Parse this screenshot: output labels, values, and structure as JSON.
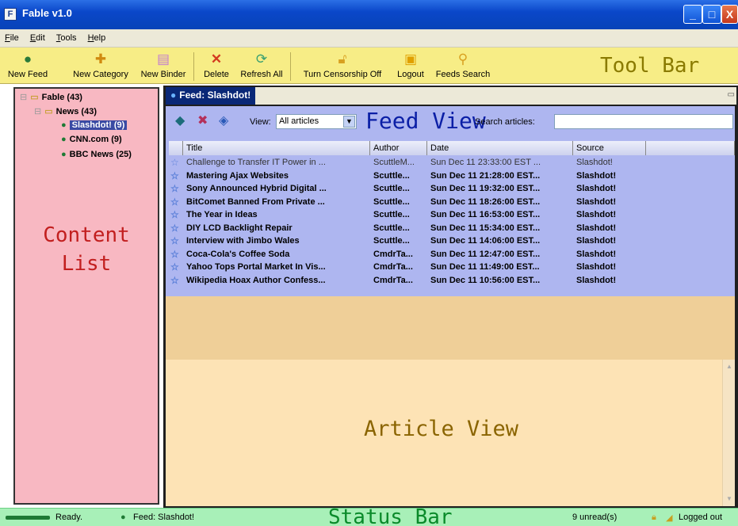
{
  "window": {
    "title": "Fable v1.0",
    "minimize": "_",
    "maximize": "□",
    "close": "X"
  },
  "menu": [
    "File",
    "Edit",
    "Tools",
    "Help"
  ],
  "toolbar": {
    "caption": "Tool Bar",
    "buttons": [
      {
        "label": "New Feed",
        "icon": "globe-icon"
      },
      {
        "label": "New Category",
        "icon": "folder-plus-icon"
      },
      {
        "label": "New Binder",
        "icon": "binder-icon"
      },
      {
        "label": "Delete",
        "icon": "delete-x-icon"
      },
      {
        "label": "Refresh All",
        "icon": "refresh-icon"
      },
      {
        "label": "Turn Censorship Off",
        "icon": "padlock-icon"
      },
      {
        "label": "Logout",
        "icon": "logout-icon"
      },
      {
        "label": "Feeds Search",
        "icon": "magnifier-icon"
      }
    ]
  },
  "content_list": {
    "caption_line1": "Content",
    "caption_line2": "List",
    "tree": {
      "root": "Fable (43)",
      "category": "News (43)",
      "feeds": [
        "Slashdot! (9)",
        "CNN.com (9)",
        "BBC News (25)"
      ]
    }
  },
  "feed_panel": {
    "tab_title": "Feed: Slashdot!"
  },
  "feed_view": {
    "caption": "Feed View",
    "view_label": "View:",
    "view_selected": "All articles",
    "search_label": "Search articles:",
    "search_value": "",
    "columns": [
      "Title",
      "Author",
      "Date",
      "Source"
    ],
    "rows": [
      {
        "title": "Challenge to Transfer IT Power in ...",
        "author": "ScuttleM...",
        "date": "Sun Dec 11 23:33:00 EST ...",
        "source": "Slashdot!",
        "unread": false
      },
      {
        "title": "Mastering Ajax Websites",
        "author": "Scuttle...",
        "date": "Sun Dec 11 21:28:00 EST...",
        "source": "Slashdot!",
        "unread": true
      },
      {
        "title": "Sony Announced Hybrid Digital ...",
        "author": "Scuttle...",
        "date": "Sun Dec 11 19:32:00 EST...",
        "source": "Slashdot!",
        "unread": true
      },
      {
        "title": "BitComet Banned From Private ...",
        "author": "Scuttle...",
        "date": "Sun Dec 11 18:26:00 EST...",
        "source": "Slashdot!",
        "unread": true
      },
      {
        "title": "The Year in Ideas",
        "author": "Scuttle...",
        "date": "Sun Dec 11 16:53:00 EST...",
        "source": "Slashdot!",
        "unread": true
      },
      {
        "title": "DIY LCD Backlight Repair",
        "author": "Scuttle...",
        "date": "Sun Dec 11 15:34:00 EST...",
        "source": "Slashdot!",
        "unread": true
      },
      {
        "title": "Interview with Jimbo Wales",
        "author": "Scuttle...",
        "date": "Sun Dec 11 14:06:00 EST...",
        "source": "Slashdot!",
        "unread": true
      },
      {
        "title": "Coca-Cola's Coffee Soda",
        "author": "CmdrTa...",
        "date": "Sun Dec 11 12:47:00 EST...",
        "source": "Slashdot!",
        "unread": true
      },
      {
        "title": "Yahoo Tops Portal Market In Vis...",
        "author": "CmdrTa...",
        "date": "Sun Dec 11 11:49:00 EST...",
        "source": "Slashdot!",
        "unread": true
      },
      {
        "title": "Wikipedia Hoax Author Confess...",
        "author": "CmdrTa...",
        "date": "Sun Dec 11 10:56:00 EST...",
        "source": "Slashdot!",
        "unread": true
      }
    ]
  },
  "article_view": {
    "caption": "Article View"
  },
  "status_bar": {
    "caption": "Status Bar",
    "ready": "Ready.",
    "feed": "Feed: Slashdot!",
    "unread": "9 unread(s)",
    "login": "Logged out"
  }
}
